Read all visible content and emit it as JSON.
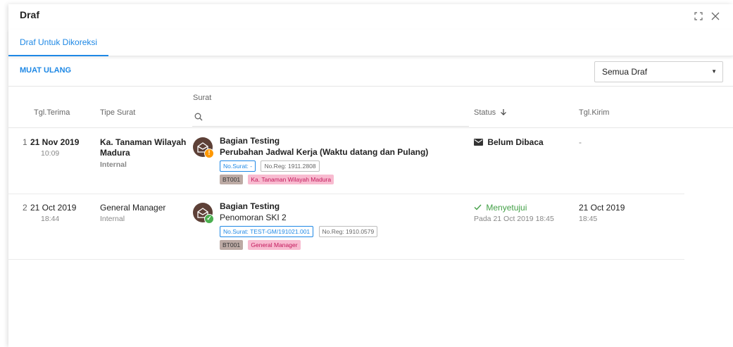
{
  "window": {
    "title": "Draf"
  },
  "tabs": [
    {
      "label": "Draf Untuk Dikoreksi",
      "active": true
    }
  ],
  "toolbar": {
    "reload_label": "MUAT ULANG",
    "filter_value": "Semua Draf"
  },
  "columns": {
    "tgl_terima": "Tgl.Terima",
    "tipe_surat": "Tipe Surat",
    "surat": "Surat",
    "status": "Status",
    "tgl_kirim": "Tgl.Kirim"
  },
  "rows": [
    {
      "num": "1",
      "date": "21 Nov 2019",
      "time": "10:09",
      "tipe": "Ka. Tanaman Wilayah Madura",
      "tipe_sub": "Internal",
      "from": "Bagian Testing",
      "subject": "Perubahan Jadwal Kerja (Waktu datang dan Pulang)",
      "no_surat": "No.Surat: -",
      "no_reg": "No.Reg: 1911.2808",
      "tag_code": "BT001",
      "tag_name": "Ka. Tanaman Wilayah Madura",
      "status": "Belum Dibaca",
      "status_sub": "",
      "kirim_date": "-",
      "kirim_time": "",
      "unread": true
    },
    {
      "num": "2",
      "date": "21 Oct 2019",
      "time": "18:44",
      "tipe": "General Manager",
      "tipe_sub": "Internal",
      "from": "Bagian Testing",
      "subject": "Penomoran SKI 2",
      "no_surat": "No.Surat: TEST-GM/191021.001",
      "no_reg": "No.Reg: 1910.0579",
      "tag_code": "BT001",
      "tag_name": "General Manager",
      "status": "Menyetujui",
      "status_sub": "Pada 21 Oct 2019 18:45",
      "kirim_date": "21 Oct 2019",
      "kirim_time": "18:45",
      "unread": false
    }
  ],
  "colors": {
    "accent": "#1e88e5",
    "approve": "#43a047",
    "warn": "#ff9800"
  }
}
